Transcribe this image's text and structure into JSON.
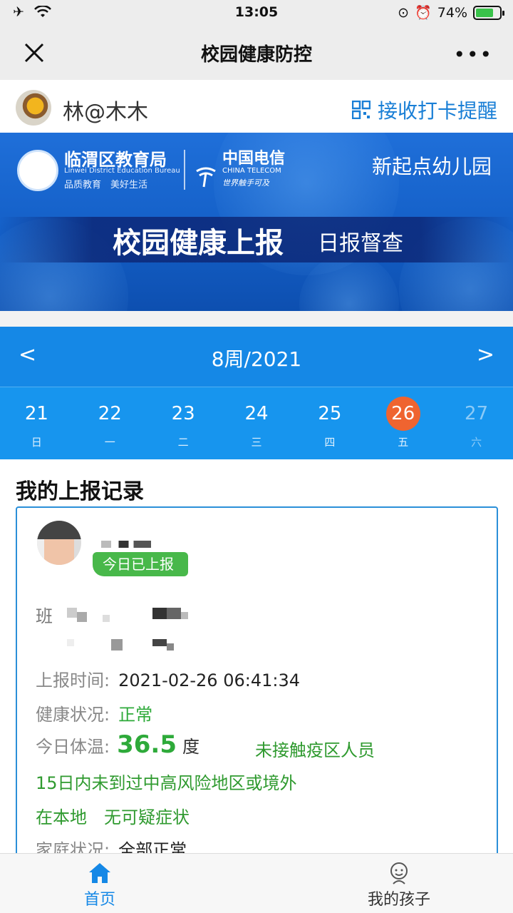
{
  "status_bar": {
    "time": "13:05",
    "battery": "74%",
    "battery_level": 0.74
  },
  "nav": {
    "title": "校园健康防控"
  },
  "user": {
    "name": "林@木木",
    "remind_label": "接收打卡提醒"
  },
  "banner": {
    "edu_bureau": "临渭区教育局",
    "edu_bureau_en": "Linwei District Education Bureau",
    "edu_slogan": "品质教育　美好生活",
    "telecom": "中国电信",
    "telecom_en": "CHINA TELECOM",
    "telecom_slogan": "世界触手可及",
    "school": "新起点幼儿园",
    "title": "校园健康上报",
    "subtitle": "日报督查"
  },
  "week": {
    "prev": "<",
    "next": ">",
    "label": "8周/2021",
    "days": [
      {
        "num": "21",
        "weekday": "日"
      },
      {
        "num": "22",
        "weekday": "一"
      },
      {
        "num": "23",
        "weekday": "二"
      },
      {
        "num": "24",
        "weekday": "三"
      },
      {
        "num": "25",
        "weekday": "四"
      },
      {
        "num": "26",
        "weekday": "五"
      },
      {
        "num": "27",
        "weekday": "六"
      }
    ]
  },
  "records": {
    "title": "我的上报记录",
    "badge": "今日已上报",
    "class_label": "班",
    "report_time_label": "上报时间:",
    "report_time": "2021-02-26 06:41:34",
    "health_label": "健康状况:",
    "health": "正常",
    "temp_label": "今日体温:",
    "temp": "36.5",
    "temp_unit": "度",
    "contact": "未接触疫区人员",
    "travel": "15日内未到过中高风险地区或境外",
    "local": "在本地　无可疑症状",
    "family_label": "家庭状况:",
    "family": "全部正常"
  },
  "tabbar": {
    "home": "首页",
    "kids": "我的孩子"
  },
  "colors": {
    "accent": "#1588e6",
    "active_day": "#ef6430",
    "badge_green": "#48b84a",
    "text_green": "#2eaa3a"
  }
}
